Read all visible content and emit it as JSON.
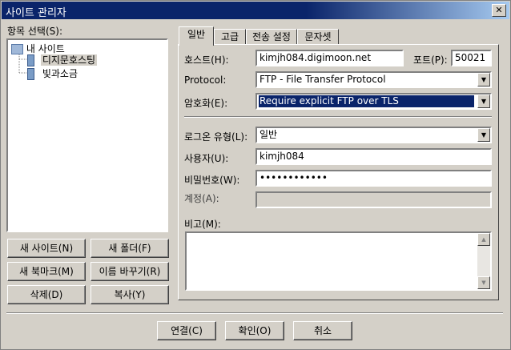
{
  "window": {
    "title": "사이트 관리자",
    "close_glyph": "✕"
  },
  "tree": {
    "heading": "항목 선택(S):",
    "root": "내 사이트",
    "items": [
      "디지문호스팅",
      "빛과소금"
    ]
  },
  "left_buttons": {
    "new_site": "새 사이트(N)",
    "new_folder": "새 폴더(F)",
    "new_bookmark": "새 북마크(M)",
    "rename": "이름 바꾸기(R)",
    "delete": "삭제(D)",
    "copy": "복사(Y)"
  },
  "tabs": [
    "일반",
    "고급",
    "전송 설정",
    "문자셋"
  ],
  "general": {
    "host_label": "호스트(H):",
    "host_value": "kimjh084.digimoon.net",
    "port_label": "포트(P):",
    "port_value": "50021",
    "protocol_label": "Protocol:",
    "protocol_value": "FTP - File Transfer Protocol",
    "encryption_label": "암호화(E):",
    "encryption_value": "Require explicit FTP over TLS",
    "logon_label": "로그온 유형(L):",
    "logon_value": "일반",
    "user_label": "사용자(U):",
    "user_value": "kimjh084",
    "password_label": "비밀번호(W):",
    "password_value": "••••••••••••",
    "account_label": "계정(A):",
    "account_value": "",
    "comments_label": "비고(M):"
  },
  "bottom_buttons": {
    "connect": "연결(C)",
    "ok": "확인(O)",
    "cancel": "취소"
  }
}
